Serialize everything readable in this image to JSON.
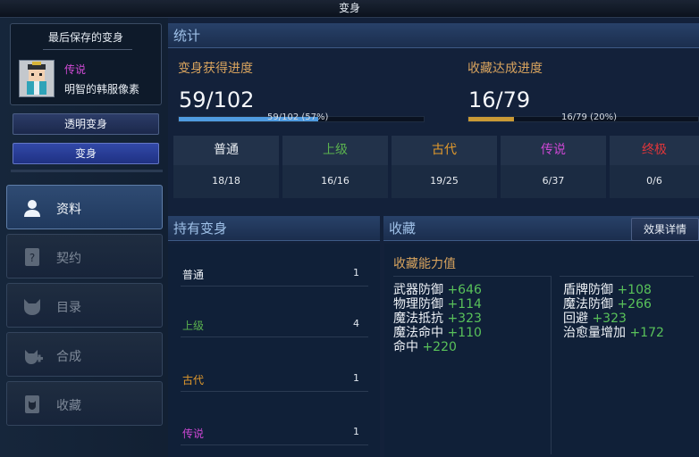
{
  "window": {
    "title": "变身"
  },
  "sidebar": {
    "saved_title": "最后保存的变身",
    "saved_grade": "传说",
    "saved_name": "明智的韩服像素",
    "transparent_button": "透明变身",
    "transform_button": "变身",
    "nav": [
      {
        "label": "资料",
        "icon": "profile-icon",
        "active": true
      },
      {
        "label": "契约",
        "icon": "contract-icon",
        "active": false
      },
      {
        "label": "目录",
        "icon": "catalog-icon",
        "active": false
      },
      {
        "label": "合成",
        "icon": "synthesis-icon",
        "active": false
      },
      {
        "label": "收藏",
        "icon": "collection-icon",
        "active": false
      }
    ]
  },
  "stats": {
    "title": "统计",
    "acquire": {
      "label": "变身获得进度",
      "value": "59/102",
      "bar_text": "59/102 (57%)",
      "fraction": 0.57,
      "color": "#4f9be0"
    },
    "collect": {
      "label": "收藏达成进度",
      "value": "16/79",
      "bar_text": "16/79 (20%)",
      "fraction": 0.2,
      "color": "#c99a36"
    },
    "grades": [
      {
        "name": "普通",
        "count": "18/18",
        "color": "#e9edf2"
      },
      {
        "name": "上级",
        "count": "16/16",
        "color": "#5bb24f"
      },
      {
        "name": "古代",
        "count": "19/25",
        "color": "#e39a2b"
      },
      {
        "name": "传说",
        "count": "6/37",
        "color": "#cc47d3"
      },
      {
        "name": "终极",
        "count": "0/6",
        "color": "#e0363a"
      }
    ]
  },
  "owned": {
    "title": "持有变身",
    "rows": [
      {
        "name": "普通",
        "count": "1",
        "color": "#eef2f7"
      },
      {
        "name": "上级",
        "count": "4",
        "color": "#5bb24f"
      },
      {
        "name": "古代",
        "count": "1",
        "color": "#e39a2b"
      },
      {
        "name": "传说",
        "count": "1",
        "color": "#cc47d3"
      }
    ]
  },
  "collection": {
    "title": "收藏",
    "detail_button": "效果详情",
    "ability_title": "收藏能力值",
    "left_stats": [
      {
        "name": "武器防御",
        "value": "+646"
      },
      {
        "name": "物理防御",
        "value": "+114"
      },
      {
        "name": "魔法抵抗",
        "value": "+323"
      },
      {
        "name": "魔法命中",
        "value": "+110"
      },
      {
        "name": "命中",
        "value": "+220"
      }
    ],
    "right_stats": [
      {
        "name": "盾牌防御",
        "value": "+108"
      },
      {
        "name": "魔法防御",
        "value": "+266"
      },
      {
        "name": "回避",
        "value": "+323"
      },
      {
        "name": "治愈量增加",
        "value": "+172"
      }
    ]
  }
}
